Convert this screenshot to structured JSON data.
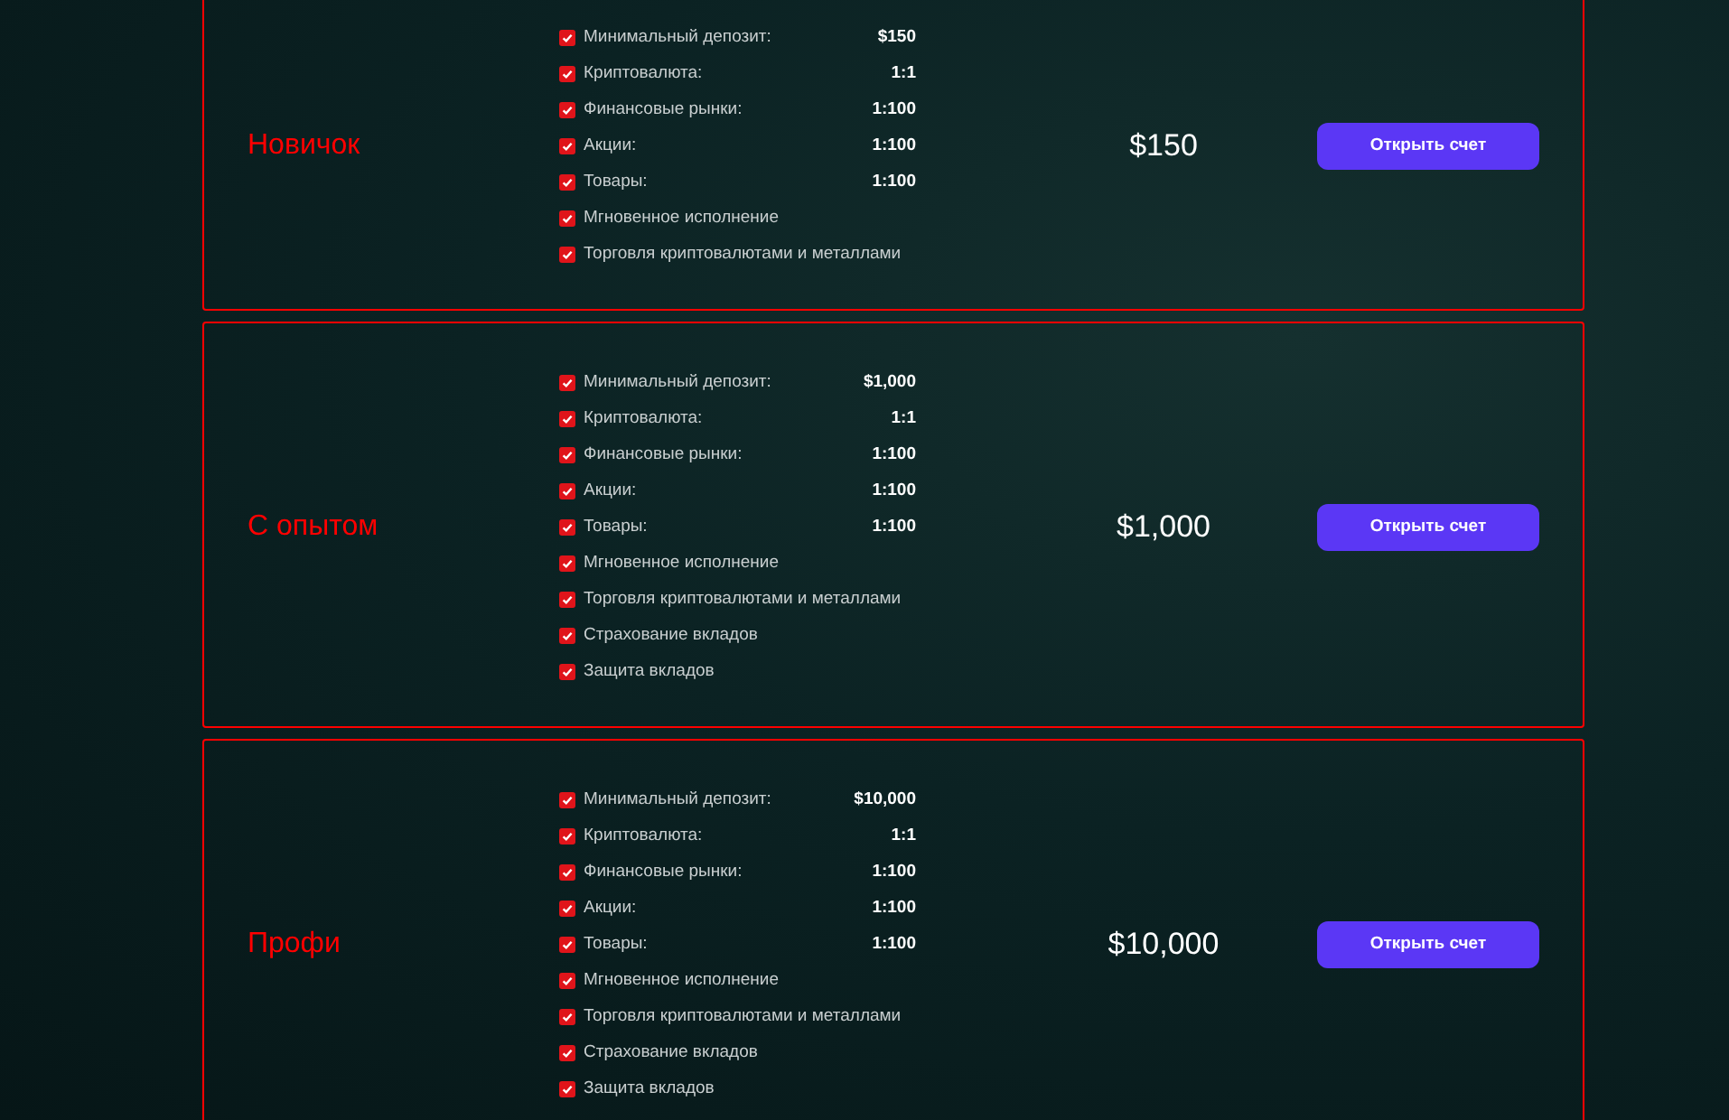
{
  "plans": [
    {
      "title": "Новичок",
      "price": "$150",
      "button": "Открыть счет",
      "features": [
        {
          "label": "Минимальный депозит:",
          "value": "$150"
        },
        {
          "label": "Криптовалюта:",
          "value": "1:1"
        },
        {
          "label": "Финансовые рынки:",
          "value": "1:100"
        },
        {
          "label": "Акции:",
          "value": "1:100"
        },
        {
          "label": "Товары:",
          "value": "1:100"
        },
        {
          "label": "Мгновенное исполнение"
        },
        {
          "label": "Торговля криптовалютами и металлами"
        }
      ]
    },
    {
      "title": "С опытом",
      "price": "$1,000",
      "button": "Открыть счет",
      "features": [
        {
          "label": "Минимальный депозит:",
          "value": "$1,000"
        },
        {
          "label": "Криптовалюта:",
          "value": "1:1"
        },
        {
          "label": "Финансовые рынки:",
          "value": "1:100"
        },
        {
          "label": "Акции:",
          "value": "1:100"
        },
        {
          "label": "Товары:",
          "value": "1:100"
        },
        {
          "label": "Мгновенное исполнение"
        },
        {
          "label": "Торговля криптовалютами и металлами"
        },
        {
          "label": "Страхование вкладов"
        },
        {
          "label": "Защита вкладов"
        }
      ]
    },
    {
      "title": "Профи",
      "price": "$10,000",
      "button": "Открыть счет",
      "features": [
        {
          "label": "Минимальный депозит:",
          "value": "$10,000"
        },
        {
          "label": "Криптовалюта:",
          "value": "1:1"
        },
        {
          "label": "Финансовые рынки:",
          "value": "1:100"
        },
        {
          "label": "Акции:",
          "value": "1:100"
        },
        {
          "label": "Товары:",
          "value": "1:100"
        },
        {
          "label": "Мгновенное исполнение"
        },
        {
          "label": "Торговля криптовалютами и металлами"
        },
        {
          "label": "Страхование вкладов"
        },
        {
          "label": "Защита вкладов"
        }
      ]
    }
  ]
}
